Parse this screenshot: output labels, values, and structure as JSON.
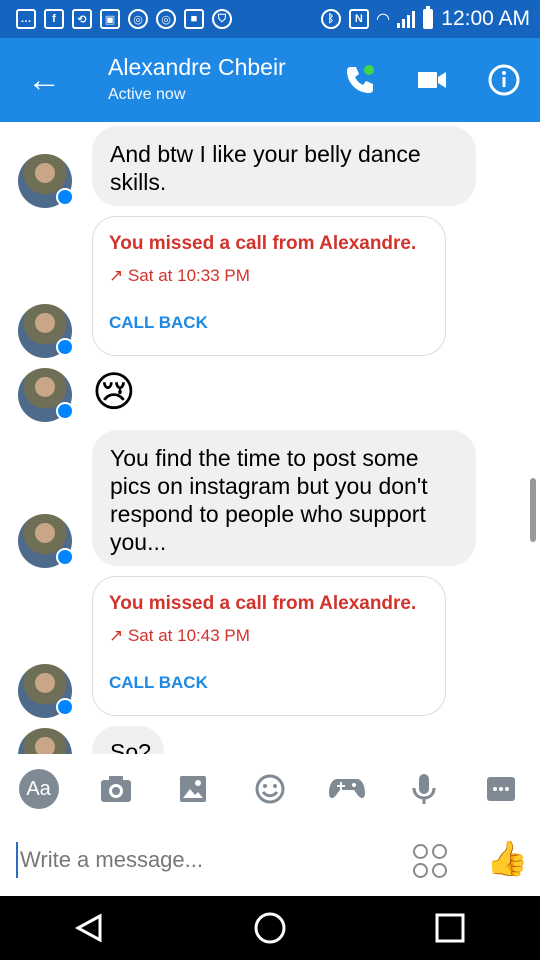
{
  "status_bar": {
    "time": "12:00 AM",
    "left_icons": [
      "notification-icon",
      "facebook-icon",
      "refresh-icon",
      "image-icon",
      "instagram-icon",
      "instagram-icon",
      "message-icon",
      "shield-icon"
    ],
    "right_icons": [
      "bluetooth-icon",
      "nfc-icon",
      "wifi-icon",
      "signal-icon",
      "battery-icon"
    ]
  },
  "header": {
    "contact_name": "Alexandre Chbeir",
    "status": "Active now",
    "accent_color": "#1e88e5"
  },
  "messages": [
    {
      "type": "text",
      "text": "And btw I like your belly dance skills."
    },
    {
      "type": "missed_call",
      "title": "You missed a call from Alexandre.",
      "time": "Sat at 10:33 PM",
      "action": "CALL BACK"
    },
    {
      "type": "emoji",
      "text": "😢"
    },
    {
      "type": "text",
      "text": "You find the time to post some pics on instagram but you don't respond to people who support you..."
    },
    {
      "type": "missed_call",
      "title": "You missed a call from Alexandre.",
      "time": "Sat at 10:43 PM",
      "action": "CALL BACK"
    },
    {
      "type": "text",
      "text": "So?"
    }
  ],
  "composer": {
    "toolbar": [
      "Aa",
      "camera-icon",
      "gallery-icon",
      "emoji-icon",
      "game-icon",
      "microphone-icon",
      "more-icon"
    ],
    "placeholder": "Write a message..."
  },
  "system_nav": [
    "back-icon",
    "home-icon",
    "recent-apps-icon"
  ]
}
